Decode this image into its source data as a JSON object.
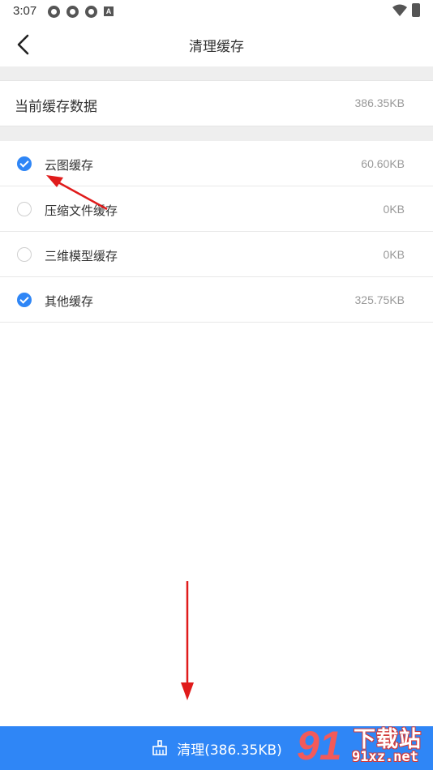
{
  "status": {
    "time": "3:07",
    "letter_badge": "A",
    "icons": [
      "app-notification-icon",
      "app-notification-icon",
      "app-notification-icon",
      "a-badge-icon",
      "wifi-icon",
      "battery-icon"
    ]
  },
  "header": {
    "title": "清理缓存",
    "back_icon": "chevron-left-icon"
  },
  "summary": {
    "label": "当前缓存数据",
    "value": "386.35KB"
  },
  "cache_items": [
    {
      "label": "云图缓存",
      "size": "60.60KB",
      "checked": true
    },
    {
      "label": "压缩文件缓存",
      "size": "0KB",
      "checked": false
    },
    {
      "label": "三维模型缓存",
      "size": "0KB",
      "checked": false
    },
    {
      "label": "其他缓存",
      "size": "325.75KB",
      "checked": true
    }
  ],
  "action": {
    "label": "清理(386.35KB)",
    "icon": "broom-icon"
  },
  "watermark": {
    "logo": "91",
    "text": "下载站",
    "url": "91xz.net"
  },
  "colors": {
    "accent": "#2f86f6",
    "annotation_arrow": "#e01b1b",
    "divider_bg": "#eeeeee"
  }
}
